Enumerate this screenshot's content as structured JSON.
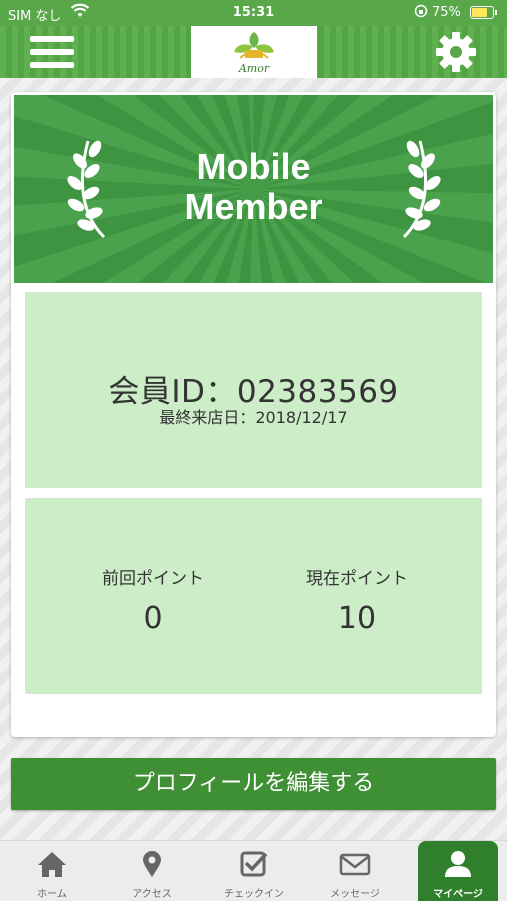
{
  "status_bar": {
    "carrier": "SIM なし",
    "time": "15:31",
    "battery": "75%"
  },
  "header": {
    "menu_icon": "hamburger-menu-icon",
    "settings_icon": "gear-icon",
    "logo_text": "Amor"
  },
  "banner": {
    "title": "Mobile\nMember"
  },
  "member": {
    "id_line": "会員ID：02383569",
    "last_visit_line": "最終来店日：2018/12/17"
  },
  "points": {
    "previous_label": "前回ポイント",
    "previous_value": "0",
    "current_label": "現在ポイント",
    "current_value": "10"
  },
  "profile_button_label": "プロフィールを編集する",
  "tabs": [
    {
      "label": "ホーム",
      "icon": "home-icon"
    },
    {
      "label": "アクセス",
      "icon": "map-pin-icon"
    },
    {
      "label": "チェックイン",
      "icon": "checkin-icon"
    },
    {
      "label": "メッセージ",
      "icon": "mail-icon"
    },
    {
      "label": "マイページ",
      "icon": "user-icon",
      "active": true
    }
  ],
  "colors": {
    "brand_green": "#58a84a",
    "banner_green": "#4aa34c",
    "panel_light_green": "#ccedc8",
    "button_green": "#3f8f35",
    "active_tab": "#2f7f2c"
  }
}
